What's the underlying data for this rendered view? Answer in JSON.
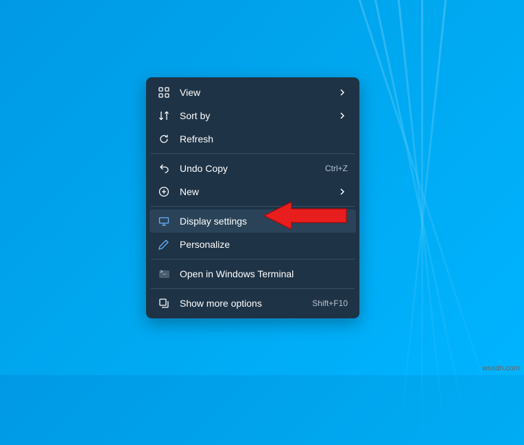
{
  "menu": {
    "items": [
      {
        "label": "View",
        "submenu": true
      },
      {
        "label": "Sort by",
        "submenu": true
      },
      {
        "label": "Refresh"
      },
      {
        "label": "Undo Copy",
        "shortcut": "Ctrl+Z"
      },
      {
        "label": "New",
        "submenu": true
      },
      {
        "label": "Display settings",
        "highlighted": true
      },
      {
        "label": "Personalize"
      },
      {
        "label": "Open in Windows Terminal"
      },
      {
        "label": "Show more options",
        "shortcut": "Shift+F10"
      }
    ]
  },
  "watermark": "wsxdn.com"
}
